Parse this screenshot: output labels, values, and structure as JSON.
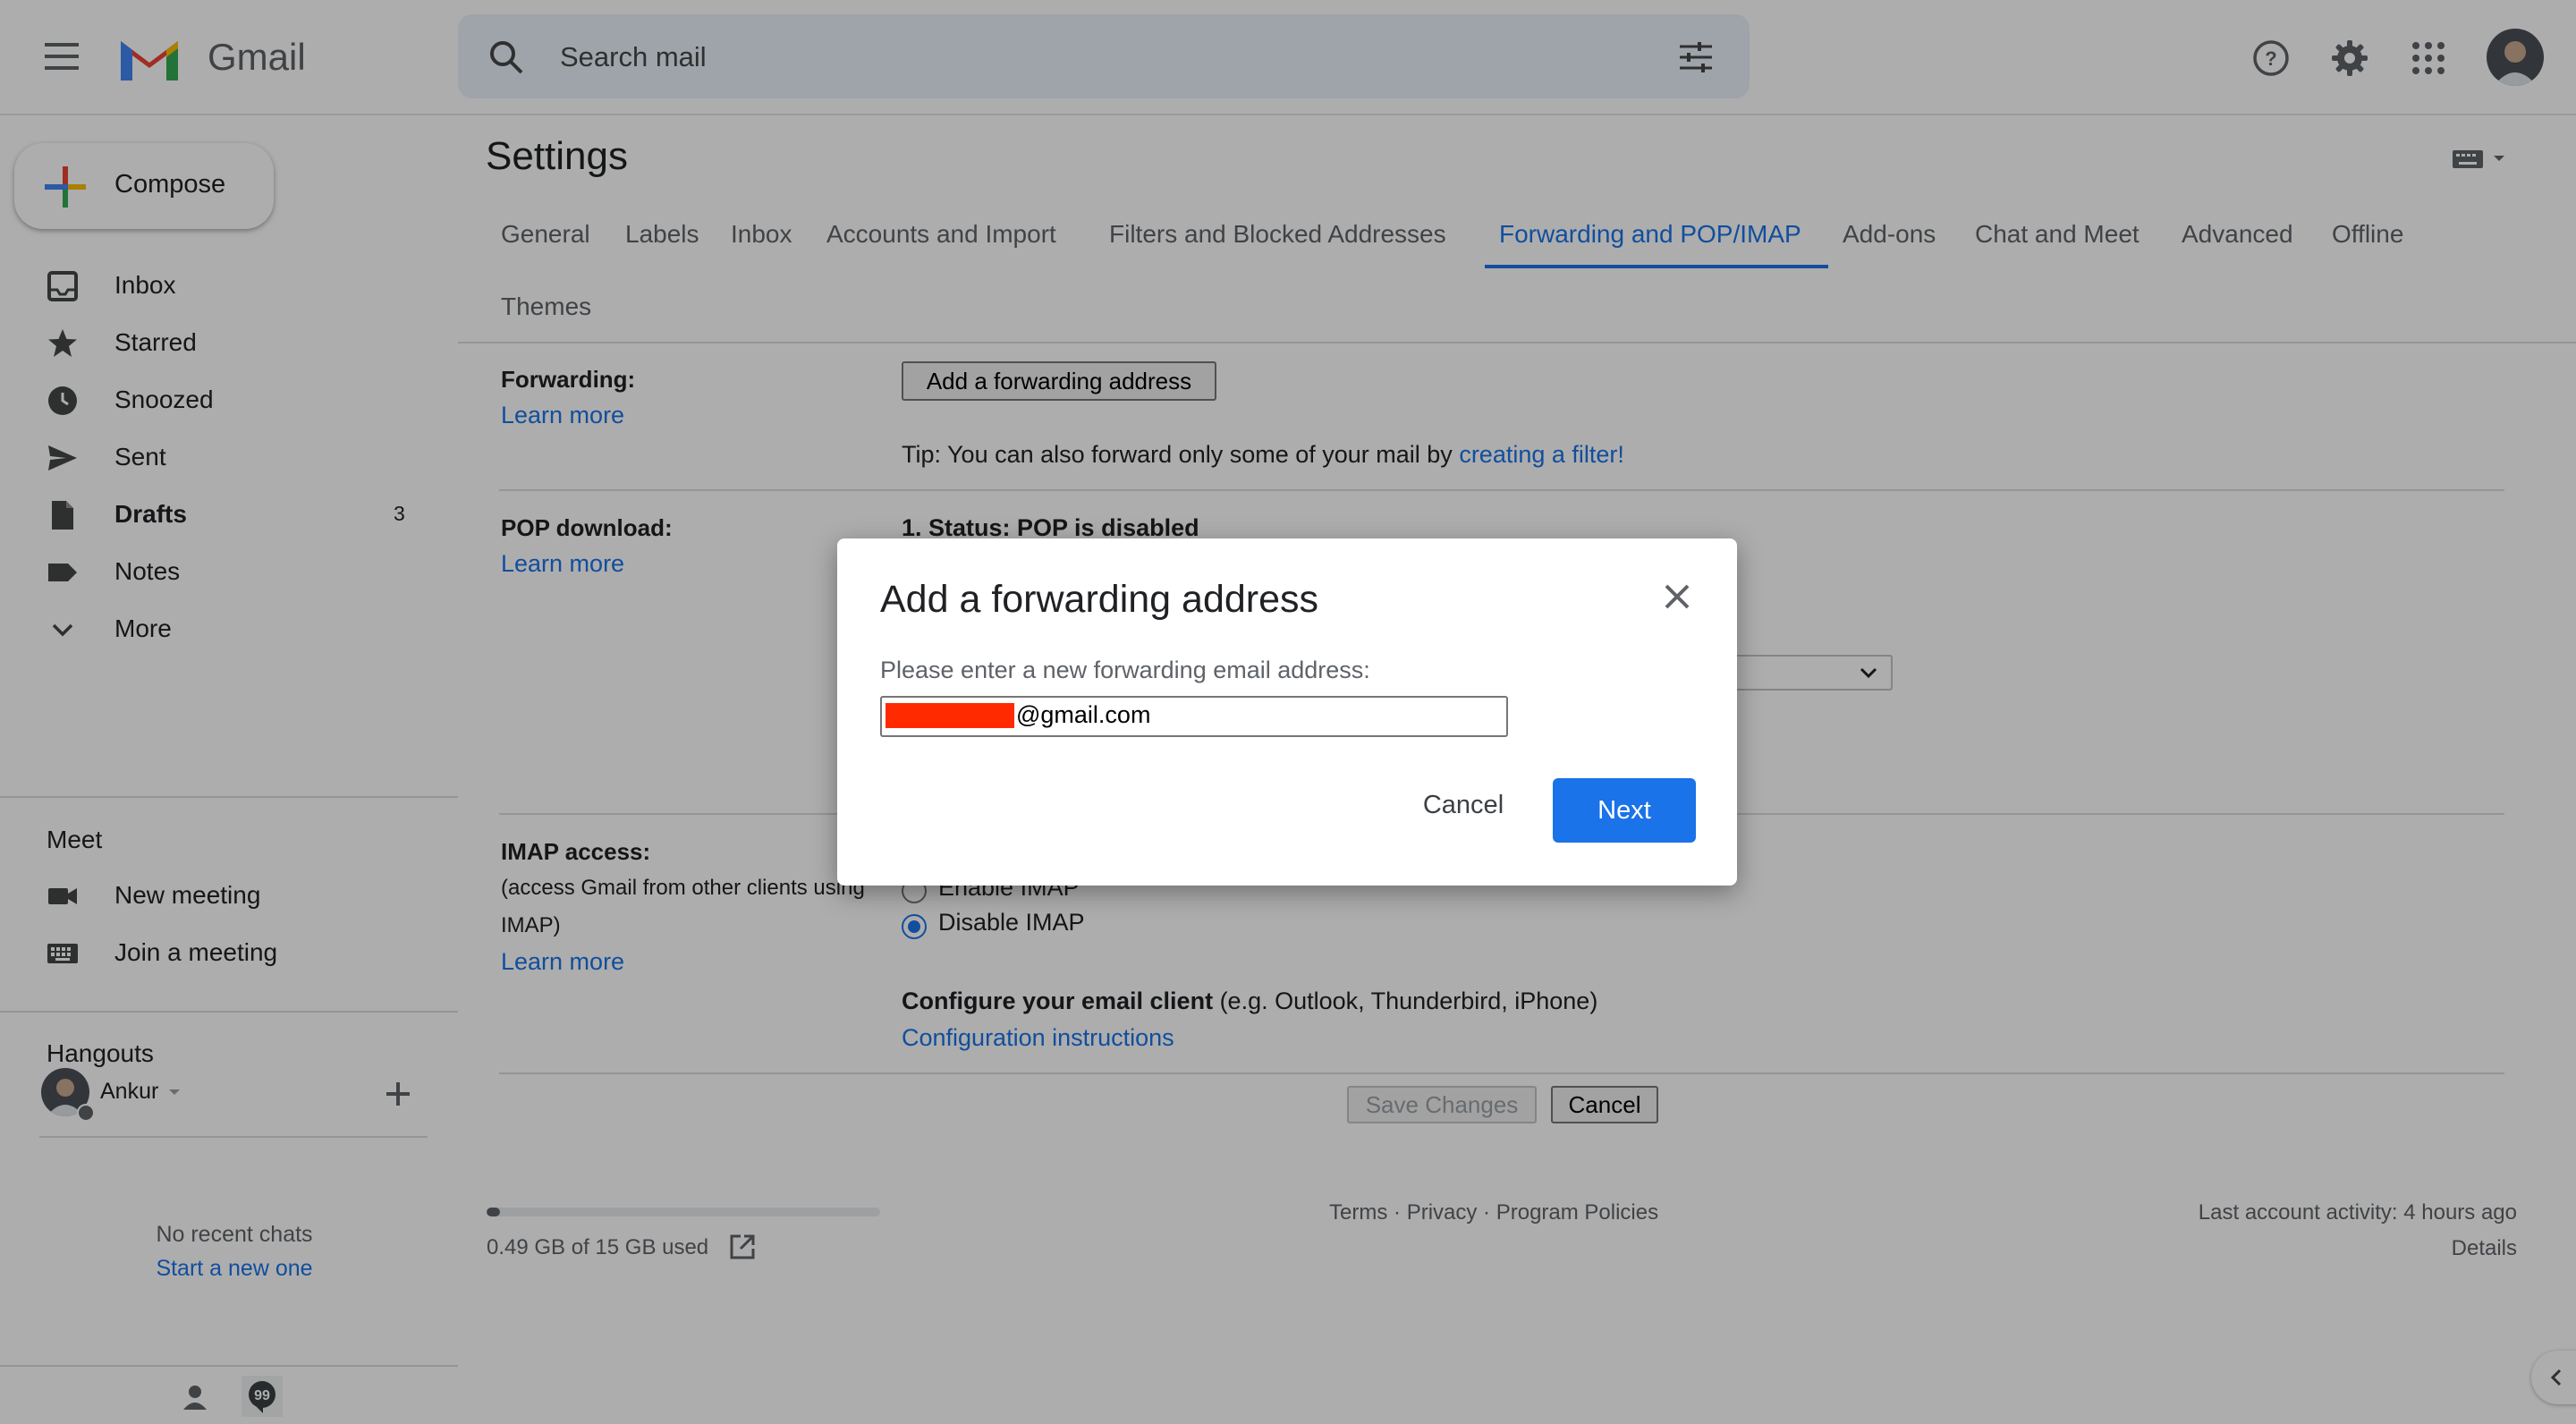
{
  "app": {
    "name": "Gmail"
  },
  "colors": {
    "accent": "#1a73e8",
    "redaction": "#ff2a00",
    "overlay": "rgba(0,0,0,0.32)"
  },
  "search": {
    "placeholder": "Search mail"
  },
  "sidebar": {
    "compose_label": "Compose",
    "items": [
      {
        "label": "Inbox",
        "icon": "inbox-icon"
      },
      {
        "label": "Starred",
        "icon": "star-icon"
      },
      {
        "label": "Snoozed",
        "icon": "clock-icon"
      },
      {
        "label": "Sent",
        "icon": "send-icon"
      },
      {
        "label": "Drafts",
        "icon": "draft-icon",
        "count": "3"
      },
      {
        "label": "Notes",
        "icon": "label-icon"
      },
      {
        "label": "More",
        "icon": "chevron-down-icon"
      }
    ],
    "meet": {
      "title": "Meet",
      "items": [
        {
          "label": "New meeting",
          "icon": "video-icon"
        },
        {
          "label": "Join a meeting",
          "icon": "keyboard-icon"
        }
      ]
    },
    "hangouts": {
      "title": "Hangouts",
      "user": "Ankur",
      "no_chats": "No recent chats",
      "start_new": "Start a new one"
    }
  },
  "settings": {
    "title": "Settings",
    "tabs": [
      "General",
      "Labels",
      "Inbox",
      "Accounts and Import",
      "Filters and Blocked Addresses",
      "Forwarding and POP/IMAP",
      "Add-ons",
      "Chat and Meet",
      "Advanced",
      "Offline",
      "Themes"
    ],
    "active_tab": "Forwarding and POP/IMAP",
    "forwarding": {
      "label": "Forwarding:",
      "learn_more": "Learn more",
      "button": "Add a forwarding address",
      "tip_prefix": "Tip: You can also forward only some of your mail by ",
      "tip_link": "creating a filter!"
    },
    "pop": {
      "label": "POP download:",
      "learn_more": "Learn more",
      "status": "1. Status: POP is disabled"
    },
    "imap": {
      "label": "IMAP access:",
      "desc_line1": "(access Gmail from other clients using",
      "desc_line2": "IMAP)",
      "learn_more": "Learn more",
      "enable": "Enable IMAP",
      "disable": "Disable IMAP",
      "selected": "Disable IMAP",
      "configure_bold": "Configure your email client",
      "configure_rest": " (e.g. Outlook, Thunderbird, iPhone)",
      "config_link": "Configuration instructions"
    },
    "save_label": "Save Changes",
    "cancel_label": "Cancel"
  },
  "footer": {
    "storage": "0.49 GB of 15 GB used",
    "storage_fraction": 0.033,
    "terms": "Terms",
    "privacy": "Privacy",
    "policies": "Program Policies",
    "sep": "·",
    "activity": "Last account activity: 4 hours ago",
    "details": "Details"
  },
  "dialog": {
    "title": "Add a forwarding address",
    "prompt": "Please enter a new forwarding email address:",
    "input_value": "@gmail.com",
    "cancel": "Cancel",
    "next": "Next"
  }
}
